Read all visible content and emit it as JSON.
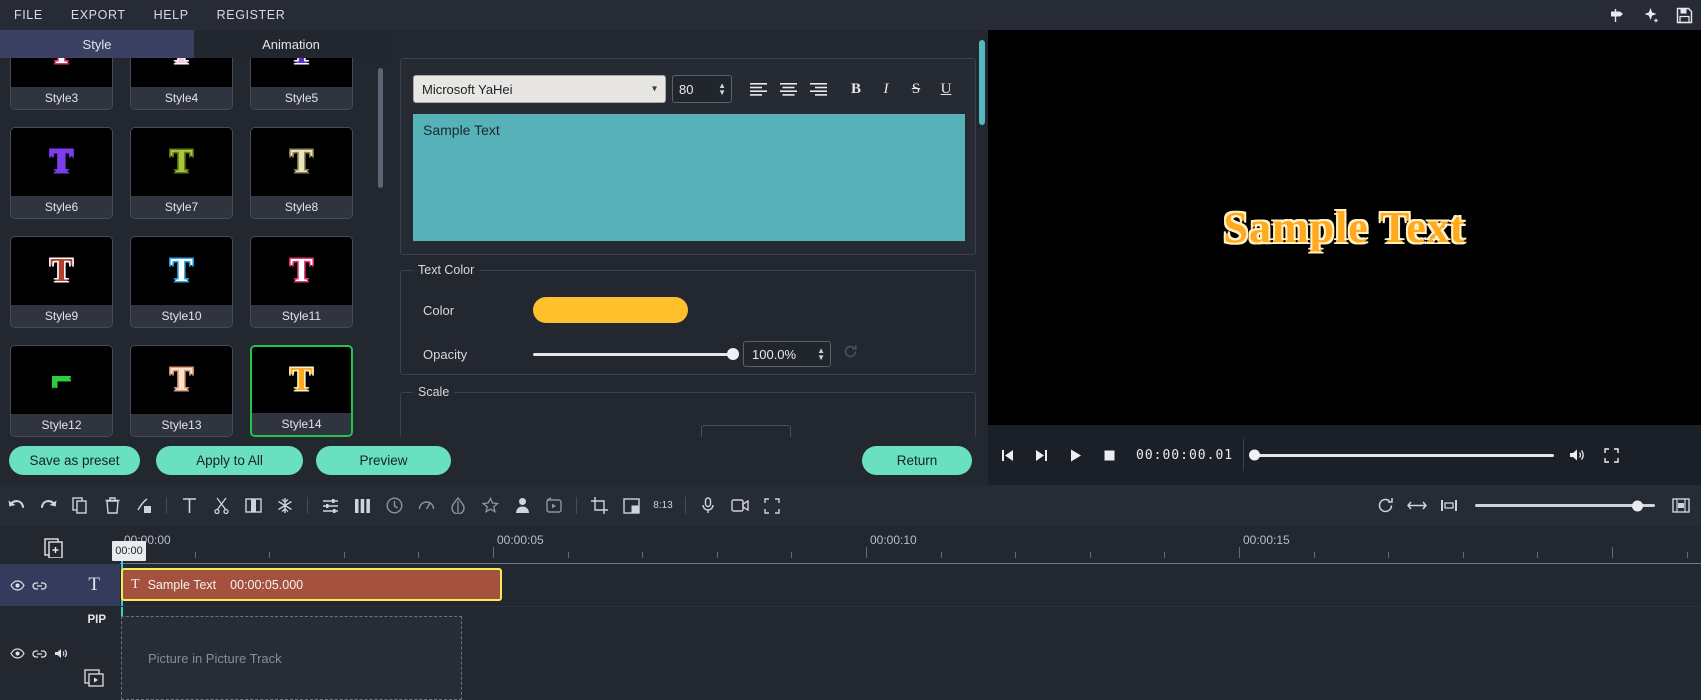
{
  "menubar": {
    "items": [
      {
        "label": "FILE",
        "name": "menu-file"
      },
      {
        "label": "EXPORT",
        "name": "menu-export"
      },
      {
        "label": "HELP",
        "name": "menu-help"
      },
      {
        "label": "REGISTER",
        "name": "menu-register"
      }
    ],
    "right_icons": [
      "signpost-icon",
      "sparkle-icon",
      "save-icon"
    ]
  },
  "tabs": [
    {
      "label": "Style",
      "active": true
    },
    {
      "label": "Animation",
      "active": false
    }
  ],
  "style_presets": [
    {
      "label": "Style3",
      "glyph": "T",
      "color": "#ffffff",
      "outline": "#e8336d",
      "selected": false
    },
    {
      "label": "Style4",
      "glyph": "T",
      "color": "#f7c9ef",
      "outline": "#ffffff",
      "selected": false
    },
    {
      "label": "Style5",
      "glyph": "T",
      "color": "#5b2ed6",
      "outline": "#ffffff",
      "selected": false
    },
    {
      "label": "Style6",
      "glyph": "T",
      "color": "#7c3cf0",
      "outline": "#7c3cf0",
      "selected": false
    },
    {
      "label": "Style7",
      "glyph": "T",
      "color": "#a8c83a",
      "outline": "#5f7a16",
      "selected": false
    },
    {
      "label": "Style8",
      "glyph": "T",
      "color": "#ece5bc",
      "outline": "#8b8456",
      "selected": false
    },
    {
      "label": "Style9",
      "glyph": "T",
      "color": "#b63f2e",
      "outline": "#ffffff",
      "selected": false
    },
    {
      "label": "Style10",
      "glyph": "T",
      "color": "#ffffff",
      "outline": "#2aa7e8",
      "selected": false
    },
    {
      "label": "Style11",
      "glyph": "T",
      "color": "#ffffff",
      "outline": "#e8336d",
      "selected": false
    },
    {
      "label": "Style12",
      "glyph": "⌐",
      "color": "#2ecc40",
      "outline": "#2ecc40",
      "selected": false
    },
    {
      "label": "Style13",
      "glyph": "T",
      "color": "#f6e3c8",
      "outline": "#d99a7a",
      "selected": false
    },
    {
      "label": "Style14",
      "glyph": "T",
      "color": "#ffa91f",
      "outline": "#fff1c4",
      "selected": true
    }
  ],
  "text_editor": {
    "font_family_value": "Microsoft YaHei",
    "font_size_value": "80",
    "content": "Sample Text",
    "align_buttons": [
      "align-left-icon",
      "align-center-icon",
      "align-right-icon"
    ],
    "style_buttons": [
      "bold-icon",
      "italic-icon",
      "strikethrough-icon",
      "underline-icon"
    ],
    "bold_label": "B",
    "italic_label": "I",
    "strike_label": "S",
    "underline_label": "U"
  },
  "text_color": {
    "group_title": "Text Color",
    "color_label": "Color",
    "color_value": "#ffc12b",
    "opacity_label": "Opacity",
    "opacity_value": "100.0%",
    "opacity_percent": 100
  },
  "scale": {
    "group_title": "Scale"
  },
  "actions": {
    "save_preset": "Save as preset",
    "apply_all": "Apply to All",
    "preview": "Preview",
    "return": "Return"
  },
  "preview": {
    "text": "Sample Text",
    "text_color": "#ffa91f",
    "timecode": "00:00:00.01",
    "controls": [
      "skip-back-icon",
      "skip-forward-icon",
      "play-icon",
      "stop-icon"
    ],
    "volume_icon": "volume-icon",
    "fullscreen_icon": "fullscreen-icon"
  },
  "timeline_toolbar": {
    "icons": [
      "undo-icon",
      "redo-icon",
      "copy-icon",
      "delete-icon",
      "split-clip-icon",
      "text-icon",
      "scissors-icon",
      "crop-frames-icon",
      "snowflake-icon",
      "audio-mixer-icon",
      "equalizer-icon",
      "clock-icon",
      "speed-icon",
      "color-drop-icon",
      "star-icon",
      "person-icon",
      "media-icon",
      "crop-icon",
      "picture-in-picture-icon",
      "aspect-ratio-icon",
      "microphone-icon",
      "record-screen-icon",
      "expand-icon"
    ],
    "aspect_label": "8:13",
    "right_icons": [
      "refresh-icon",
      "fit-width-icon",
      "marker-icon",
      "render-icon"
    ]
  },
  "timeline": {
    "add_track_icon": "add-track-icon",
    "playhead_label": "00:00",
    "ruler_labels": [
      "00:00:00",
      "00:00:05",
      "00:00:10",
      "00:00:15"
    ],
    "tracks": [
      {
        "name": "text-track",
        "type": "T",
        "icons": [
          "eye-icon",
          "link-icon"
        ],
        "clip": {
          "icon": "T",
          "label": "Sample Text",
          "duration": "00:00:05.000"
        }
      },
      {
        "name": "pip-track",
        "badge": "PIP",
        "icons": [
          "eye-icon",
          "link-icon",
          "speaker-icon"
        ],
        "placeholder": "Picture in Picture Track"
      }
    ]
  }
}
